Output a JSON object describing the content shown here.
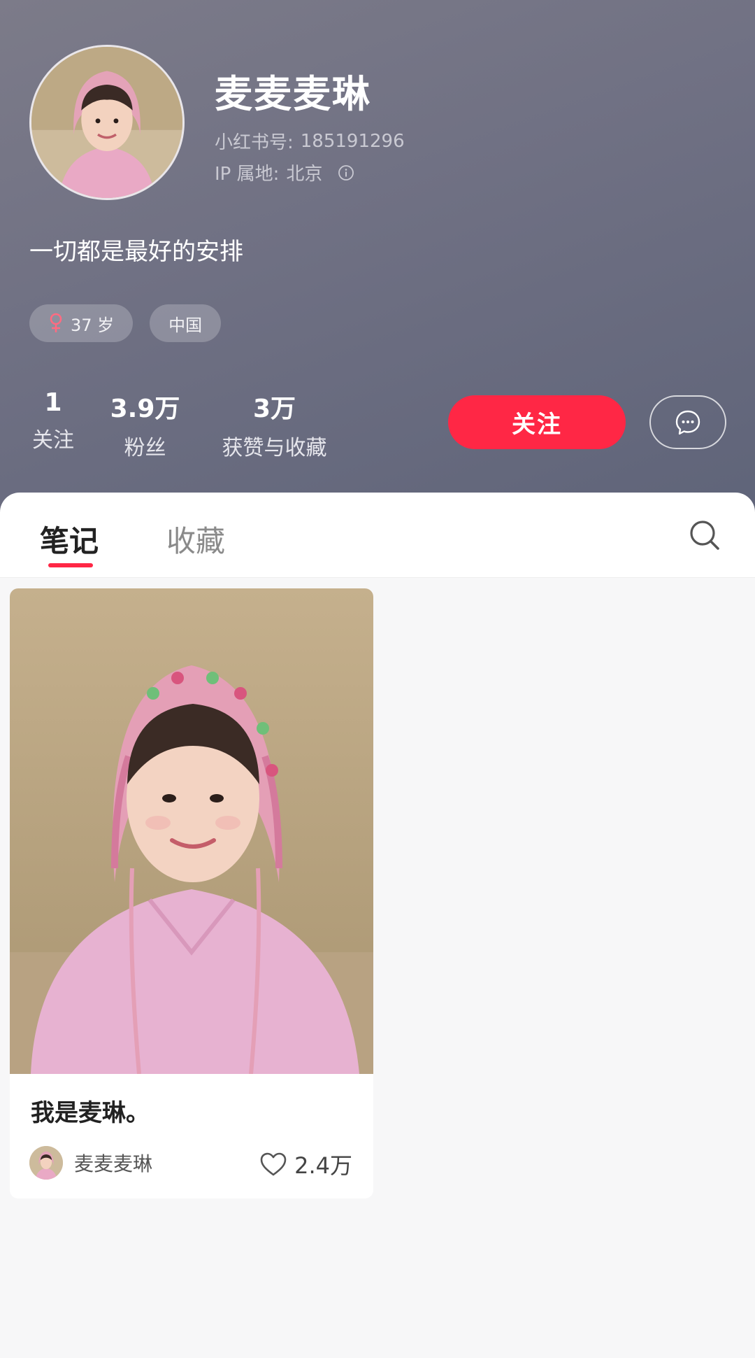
{
  "profile": {
    "nickname": "麦麦麦琳",
    "id_label": "小红书号:",
    "id_value": "185191296",
    "ip_label": "IP 属地:",
    "ip_value": "北京",
    "bio": "一切都是最好的安排",
    "tags": {
      "age": "37 岁",
      "region": "中国"
    }
  },
  "stats": [
    {
      "value": "1",
      "label": "关注"
    },
    {
      "value": "3.9万",
      "label": "粉丝"
    },
    {
      "value": "3万",
      "label": "获赞与收藏"
    }
  ],
  "actions": {
    "follow_label": "关注",
    "message_icon": "chat-bubble-icon"
  },
  "tabs": [
    {
      "label": "笔记",
      "active": true
    },
    {
      "label": "收藏",
      "active": false
    }
  ],
  "notes": [
    {
      "title": "我是麦琳。",
      "author": "麦麦麦琳",
      "likes": "2.4万"
    }
  ],
  "colors": {
    "accent": "#ff2745",
    "header_bg": "#6f7083",
    "card_bg": "#ffffff",
    "page_bg": "#f7f7f8"
  }
}
